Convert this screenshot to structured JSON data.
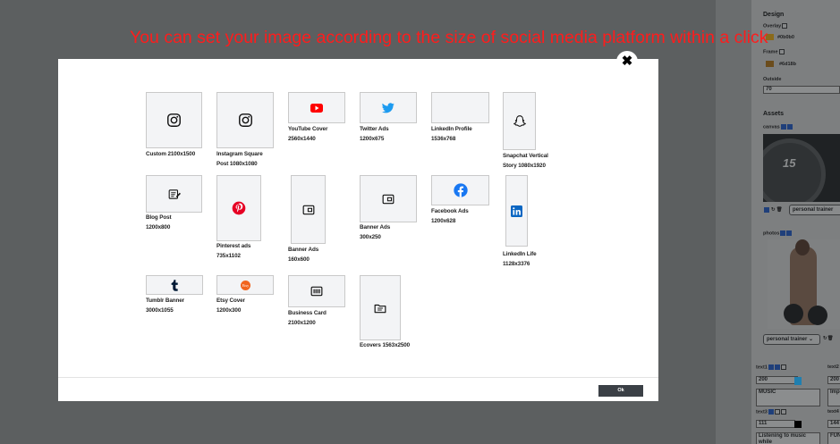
{
  "caption": "You can set your image according to the size of social media platform within a click",
  "modal": {
    "close_label": "✖",
    "ok_label": "Ok",
    "templates": [
      {
        "name": "Custom",
        "size": "2100x1500",
        "line1": "Custom 2100x1500",
        "line2": "",
        "icon": "instagram-icon"
      },
      {
        "name": "Instagram Square Post",
        "line1": "Instagram Square",
        "line2": "Post 1080x1080",
        "icon": "instagram-icon"
      },
      {
        "name": "YouTube Cover",
        "line1": "YouTube Cover",
        "line2": "2560x1440",
        "icon": "youtube-icon"
      },
      {
        "name": "Twitter Ads",
        "line1": "Twitter Ads",
        "line2": "1200x675",
        "icon": "twitter-icon"
      },
      {
        "name": "LinkedIn Profile",
        "line1": "LinkedIn Profile",
        "line2": "1536x768",
        "icon": "none"
      },
      {
        "name": "Snapchat Vertical Story",
        "line1": "Snapchat Vertical",
        "line2": "Story 1080x1920",
        "icon": "snapchat-icon"
      },
      {
        "name": "Blog Post",
        "line1": "Blog Post",
        "line2": "1200x800",
        "icon": "blog-post-icon"
      },
      {
        "name": "Pinterest ads",
        "line1": "Pinterest ads",
        "line2": "735x1102",
        "icon": "pinterest-icon"
      },
      {
        "name": "Banner Ads 160x600",
        "line1": "Banner Ads",
        "line2": "160x600",
        "icon": "banner-icon"
      },
      {
        "name": "Banner Ads 300x250",
        "line1": "Banner Ads",
        "line2": "300x250",
        "icon": "banner-icon"
      },
      {
        "name": "Facebook Ads",
        "line1": "Facebook Ads",
        "line2": "1200x628",
        "icon": "facebook-icon"
      },
      {
        "name": "LinkedIn Life",
        "line1": "LinkedIn Life",
        "line2": "1128x3376",
        "icon": "linkedin-icon"
      },
      {
        "name": "Tumblr Banner",
        "line1": "Tumblr Banner",
        "line2": "3000x1055",
        "icon": "tumblr-icon"
      },
      {
        "name": "Etsy Cover",
        "line1": "Etsy Cover",
        "line2": "1200x300",
        "icon": "etsy-icon"
      },
      {
        "name": "Business Card",
        "line1": "Business Card",
        "line2": "2100x1200",
        "icon": "business-card-icon"
      },
      {
        "name": "Ecovers",
        "line1": "Ecovers 1563x2500",
        "line2": "",
        "icon": "ecover-icon"
      }
    ]
  },
  "side_panel": {
    "design_heading": "Design",
    "overlay_label": "Overlay",
    "overlay_color_value": "#0b0b0",
    "frame_label": "Frame",
    "frame_color_value": "#6d18b",
    "outside_label": "Outside",
    "outside_value": "70",
    "assets_heading": "Assets",
    "canvas_label": "canvas",
    "canvas_image_text": "15",
    "canvas_select_value": "personal trainer",
    "photos_label": "photos",
    "photos_select_value": "personal trainer",
    "text1_label": "text1",
    "text1_size": "200",
    "text1_content": "MUSIC",
    "text2_label": "text2",
    "text2_size": "200",
    "text2_content": "Impo",
    "text3_label": "text3",
    "text3_size": "111",
    "text3_content": "Listening to music while",
    "text4_label": "text4",
    "text4_size": "144",
    "text4_content": "FUN",
    "colors": {
      "text1_swatch": "#1f7fb0",
      "text3_swatch": "#000000",
      "overlay_swatch": "#8a6a1a",
      "frame_swatch": "#6b4c1c"
    }
  },
  "colors": {
    "caption": "#ff1c1c",
    "youtube": "#ff0000",
    "twitter": "#1d9bf0",
    "pinterest": "#e60023",
    "facebook": "#1877f2",
    "linkedin": "#0a66c2",
    "tumblr": "#001935",
    "etsy": "#f1641e"
  }
}
